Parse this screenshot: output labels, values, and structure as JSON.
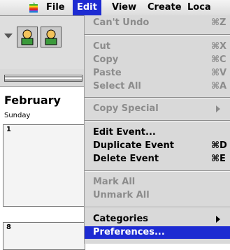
{
  "menubar": {
    "items": [
      {
        "label": "File"
      },
      {
        "label": "Edit"
      },
      {
        "label": "View"
      },
      {
        "label": "Create"
      },
      {
        "label": "Loca"
      }
    ]
  },
  "window": {
    "calendar": {
      "month": "February",
      "day_header": "Sunday",
      "cells": [
        {
          "num": "1"
        },
        {
          "num": "8"
        }
      ]
    }
  },
  "edit_menu": {
    "items": [
      {
        "label": "Can't Undo",
        "shortcut": "⌘Z"
      },
      {
        "label": "Cut",
        "shortcut": "⌘X"
      },
      {
        "label": "Copy",
        "shortcut": "⌘C"
      },
      {
        "label": "Paste",
        "shortcut": "⌘V"
      },
      {
        "label": "Select All",
        "shortcut": "⌘A"
      },
      {
        "label": "Copy Special"
      },
      {
        "label": "Edit Event..."
      },
      {
        "label": "Duplicate Event",
        "shortcut": "⌘D"
      },
      {
        "label": "Delete Event",
        "shortcut": "⌘E"
      },
      {
        "label": "Mark All"
      },
      {
        "label": "Unmark All"
      },
      {
        "label": "Categories"
      },
      {
        "label": "Preferences..."
      }
    ]
  },
  "colors": {
    "highlight": "#1d2bd2",
    "disabled_text": "#8c8c8c",
    "menu_bg": "#d9d9d9"
  }
}
